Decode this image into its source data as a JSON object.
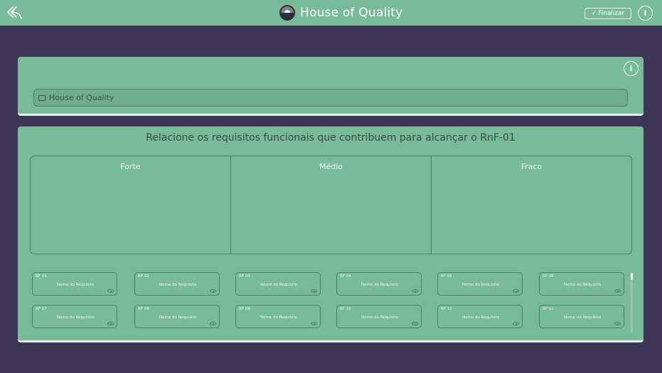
{
  "topbar": {
    "title": "House of Quality",
    "finalize_label": "Finalizar",
    "back_icon": "back-arrow-icon",
    "info_icon": "info-icon"
  },
  "panel1": {
    "title_field_value": "House of Quality",
    "info_icon": "info-icon"
  },
  "panel2": {
    "heading": "Relacione os requisitos funcionais que contribuem para alcançar o RnF-01",
    "columns": [
      "Forte",
      "Médio",
      "Fraco"
    ],
    "requirements": [
      {
        "id": "RF 01",
        "name": "Nome do Requisito"
      },
      {
        "id": "RF 02",
        "name": "Nome do Requisito"
      },
      {
        "id": "RF 03",
        "name": "Nome do Requisito"
      },
      {
        "id": "RF 04",
        "name": "Nome do Requisito"
      },
      {
        "id": "RF 05",
        "name": "Nome do Requisito"
      },
      {
        "id": "RF 06",
        "name": "Nome do Requisito"
      },
      {
        "id": "RF 07",
        "name": "Nome do Requisito"
      },
      {
        "id": "RF 08",
        "name": "Nome do Requisito"
      },
      {
        "id": "RF 09",
        "name": "Nome do Requisito"
      },
      {
        "id": "RF 10",
        "name": "Nome do Requisito"
      },
      {
        "id": "RF 11",
        "name": "Nome do Requisito"
      },
      {
        "id": "RF 12",
        "name": "Nome do Requisito"
      }
    ]
  },
  "colors": {
    "background": "#3d3556",
    "panel": "#77bb98",
    "border": "#4f7e67",
    "text_light": "#ffffff"
  }
}
